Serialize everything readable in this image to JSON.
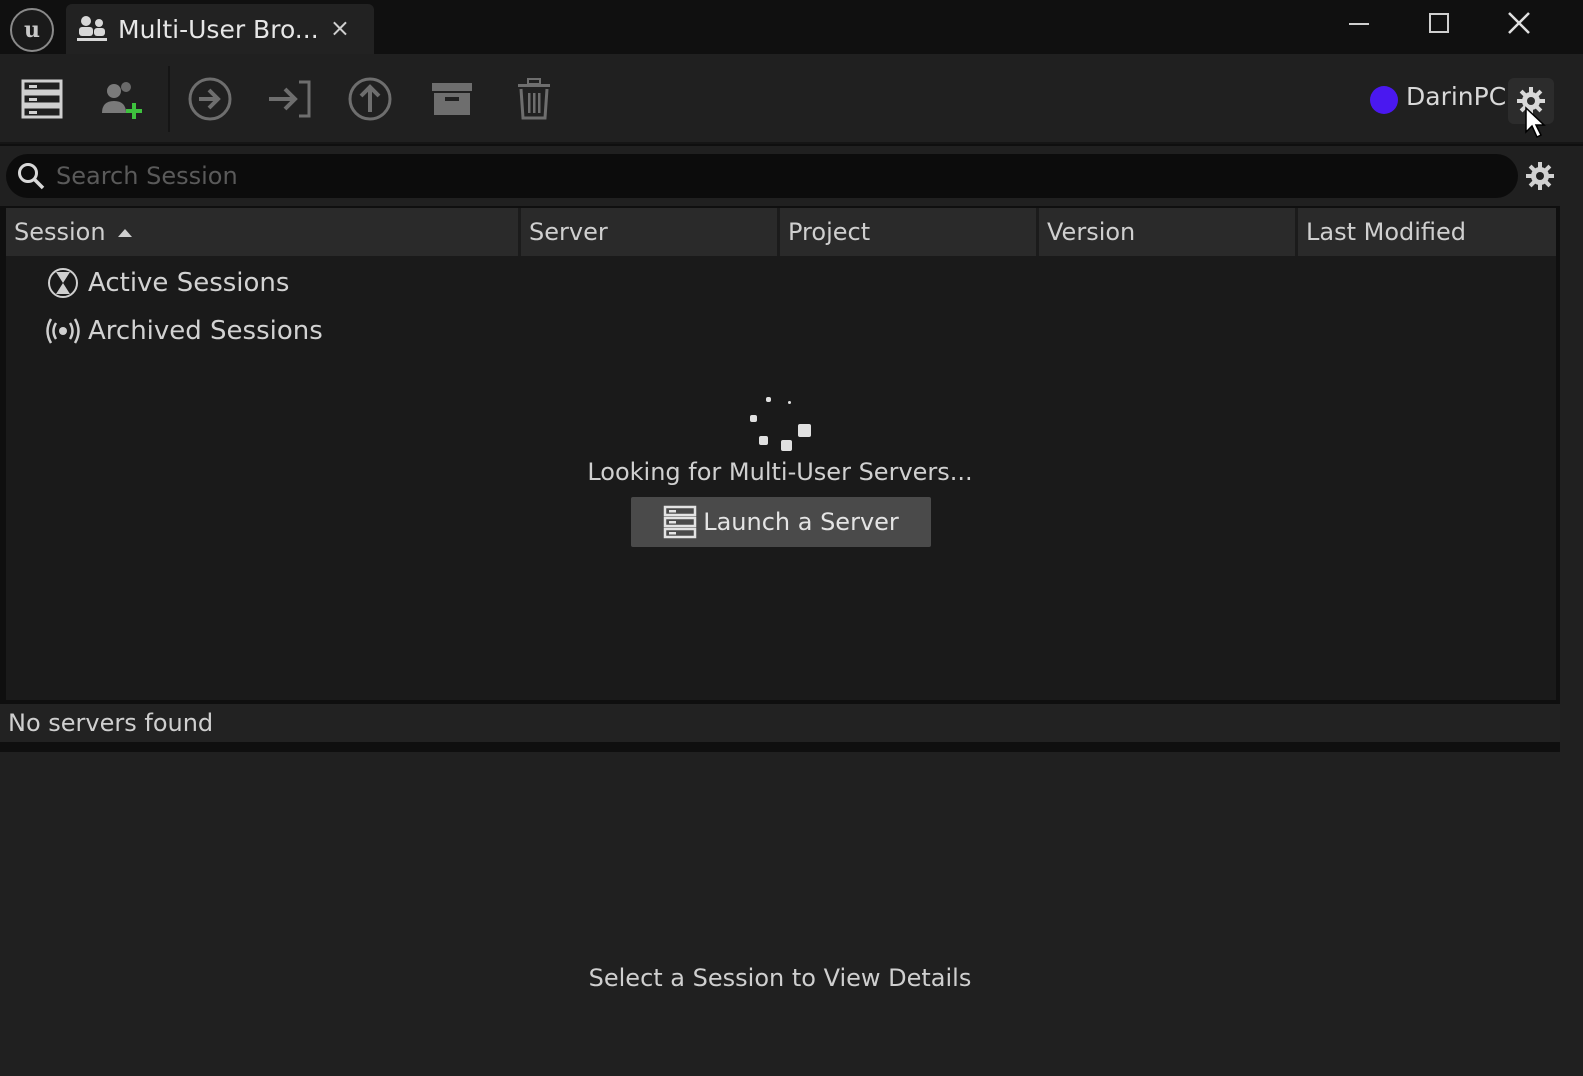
{
  "titlebar": {
    "logo_icon": "unreal-engine-logo-icon",
    "tab_icon": "multi-user-icon",
    "tab_title": "Multi-User Bro...",
    "tab_close": "×"
  },
  "toolbar": {
    "icons": [
      "server-list-icon",
      "add-user-icon",
      "join-icon",
      "login-icon",
      "upload-icon",
      "archive-icon",
      "trash-icon"
    ],
    "user_color": "#4a18f0",
    "user_name": "DarinPC"
  },
  "search": {
    "placeholder": "Search Session",
    "value": ""
  },
  "table": {
    "columns": [
      "Session",
      "Server",
      "Project",
      "Version",
      "Last Modified"
    ],
    "sort_column": "Session",
    "sort_direction": "ascending",
    "groups": [
      {
        "label": "Active Sessions",
        "icon": "active-sessions-icon"
      },
      {
        "label": "Archived Sessions",
        "icon": "archived-sessions-icon"
      }
    ]
  },
  "loading": {
    "text": "Looking for Multi-User Servers...",
    "launch_button_label": "Launch a Server"
  },
  "status": {
    "text": "No servers found"
  },
  "details": {
    "placeholder": "Select a Session to View Details"
  }
}
